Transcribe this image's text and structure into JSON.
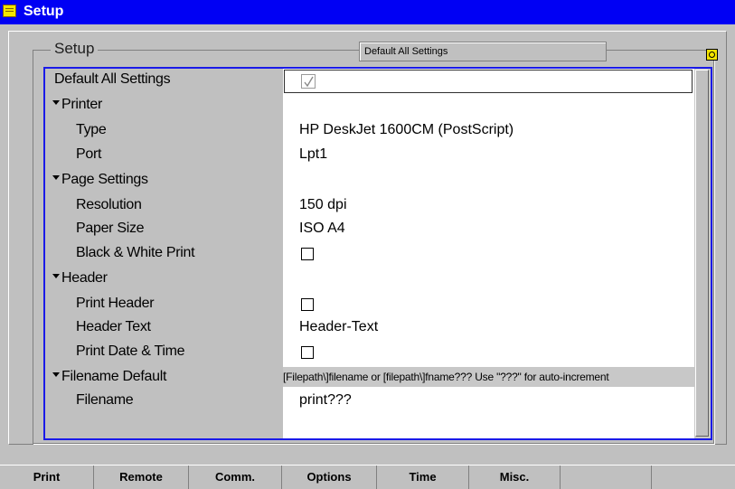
{
  "window": {
    "title": "Setup"
  },
  "group": {
    "caption": "Setup",
    "hint": "Default All Settings"
  },
  "rows": [
    {
      "label": "Default All Settings",
      "type": "checkbox",
      "checked": true
    },
    {
      "label": "Printer",
      "type": "section"
    },
    {
      "label": "Type",
      "value": "HP DeskJet 1600CM (PostScript)"
    },
    {
      "label": "Port",
      "value": "Lpt1"
    },
    {
      "label": "Page Settings",
      "type": "section"
    },
    {
      "label": "Resolution",
      "value": "150 dpi"
    },
    {
      "label": "Paper Size",
      "value": "ISO A4"
    },
    {
      "label": "Black & White Print",
      "type": "checkbox",
      "checked": false
    },
    {
      "label": "Header",
      "type": "section"
    },
    {
      "label": "Print Header",
      "type": "checkbox",
      "checked": false
    },
    {
      "label": "Header Text",
      "value": "Header-Text"
    },
    {
      "label": "Print Date & Time",
      "type": "checkbox",
      "checked": false
    },
    {
      "label": "Filename Default",
      "type": "section"
    },
    {
      "label": "Filename",
      "value": "print???"
    }
  ],
  "filename_hint": "[Filepath\\]filename or [filepath\\]fname??? Use \"???\" for auto-increment",
  "tabs": [
    "Print",
    "Remote",
    "Comm.",
    "Options",
    "Time",
    "Misc.",
    "",
    ""
  ],
  "icons": {
    "window": "menu-icon",
    "status": "quick-icon"
  },
  "colors": {
    "titlebar": "#0000f4",
    "frame_border": "#1a1ae8",
    "background": "#c0c0c0"
  }
}
